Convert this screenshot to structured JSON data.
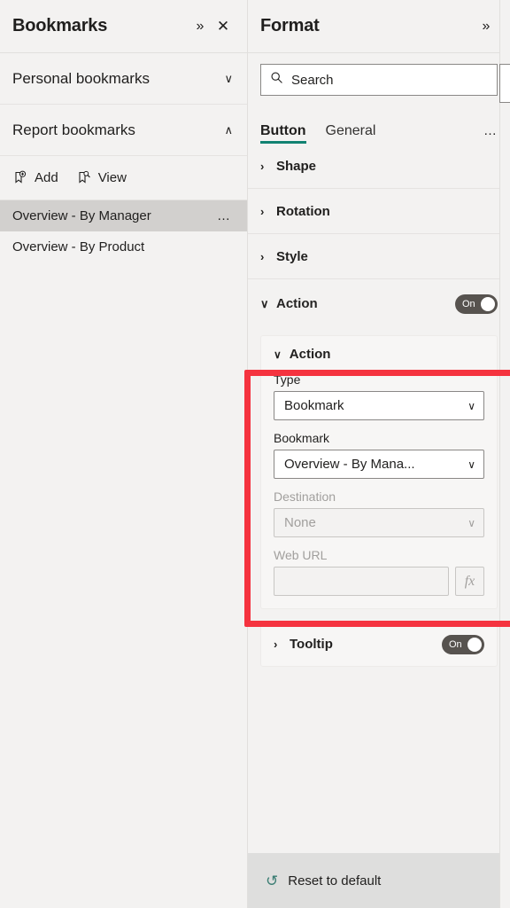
{
  "bookmarks_pane": {
    "title": "Bookmarks",
    "expand_icon": "chevron-double-right-icon",
    "close_icon": "close-icon",
    "sections": [
      {
        "label": "Personal bookmarks",
        "chevron": "∨",
        "expanded": false
      },
      {
        "label": "Report bookmarks",
        "chevron": "∧",
        "expanded": true
      }
    ],
    "actions": [
      {
        "label": "Add",
        "icon": "bookmark-add-icon"
      },
      {
        "label": "View",
        "icon": "bookmark-view-icon"
      }
    ],
    "items": [
      {
        "label": "Overview - By Manager",
        "selected": true,
        "more": "…"
      },
      {
        "label": "Overview - By Product",
        "selected": false,
        "more": ""
      }
    ]
  },
  "format_pane": {
    "title": "Format",
    "expand_icon": "chevron-double-right-icon",
    "search": {
      "placeholder": "Search",
      "value": "",
      "icon": "search-icon"
    },
    "tabs": [
      {
        "label": "Button",
        "active": true
      },
      {
        "label": "General",
        "active": false
      }
    ],
    "tabs_overflow": "…",
    "collapsed_cards": [
      {
        "label": "Shape",
        "chevron": "›"
      },
      {
        "label": "Rotation",
        "chevron": "›"
      },
      {
        "label": "Style",
        "chevron": "›"
      }
    ],
    "action_card": {
      "label": "Action",
      "chevron": "∨",
      "toggle": {
        "label": "On",
        "state": "on"
      },
      "subcard": {
        "label": "Action",
        "chevron": "∨",
        "fields": [
          {
            "label": "Type",
            "kind": "select",
            "value": "Bookmark",
            "disabled": false,
            "chevron": "∨"
          },
          {
            "label": "Bookmark",
            "kind": "select",
            "value": "Overview - By Mana...",
            "disabled": false,
            "chevron": "∨"
          },
          {
            "label": "Destination",
            "kind": "select",
            "value": "None",
            "disabled": true,
            "chevron": "∨"
          },
          {
            "label": "Web URL",
            "kind": "text-with-fx",
            "value": "",
            "disabled": true,
            "fx_label": "fx"
          }
        ]
      }
    },
    "tooltip_card": {
      "label": "Tooltip",
      "chevron": "›",
      "toggle": {
        "label": "On",
        "state": "on"
      }
    },
    "reset": {
      "label": "Reset to default",
      "icon": "undo-icon",
      "glyph": "↺"
    }
  },
  "highlight": {
    "color": "#f5333f",
    "target": "action-card-and-bookmark-selection"
  },
  "theme": {
    "accent": "#118272",
    "panel_bg": "#f3f2f1",
    "selected_row": "#d2d0ce",
    "toggle_on": "#57534f",
    "reset_strip": "#dededd"
  }
}
